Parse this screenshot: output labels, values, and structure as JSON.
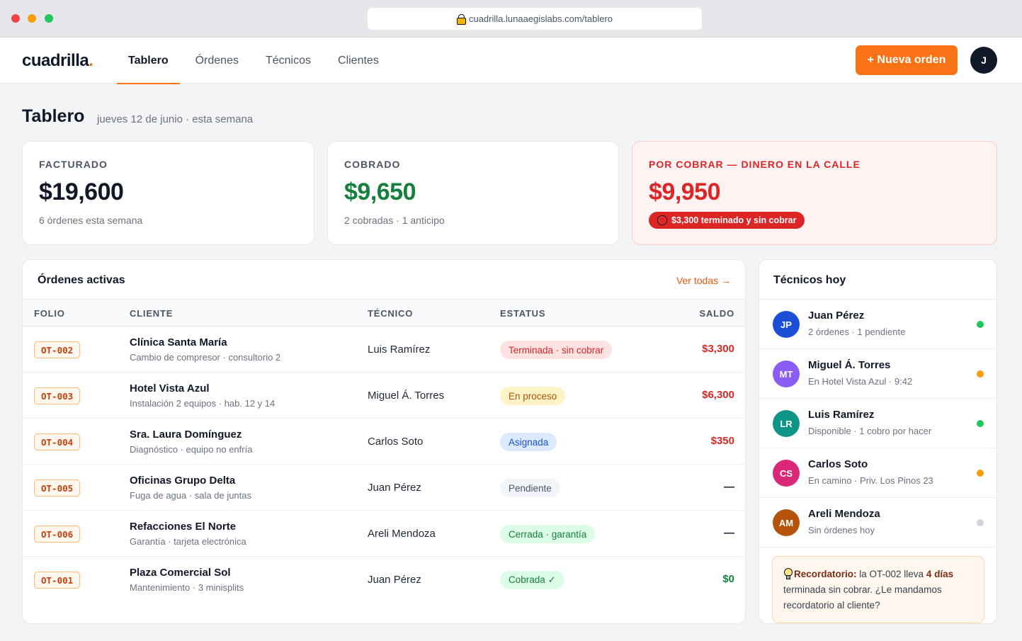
{
  "browser": {
    "url": "cuadrilla.lunaaegislabs.com/tablero"
  },
  "header": {
    "logo": "cuadrilla",
    "logo_dot": ".",
    "nav": [
      {
        "label": "Tablero",
        "active": true
      },
      {
        "label": "Órdenes",
        "active": false
      },
      {
        "label": "Técnicos",
        "active": false
      },
      {
        "label": "Clientes",
        "active": false
      }
    ],
    "new_order_label": "+ Nueva orden",
    "user_initial": "J"
  },
  "page": {
    "title": "Tablero",
    "subtitle": "jueves 12 de junio · esta semana"
  },
  "kpis": [
    {
      "label": "FACTURADO",
      "value": "$19,600",
      "note": "6 órdenes esta semana"
    },
    {
      "label": "COBRADO",
      "value": "$9,650",
      "note": "2 cobradas · 1 anticipo"
    },
    {
      "label": "POR COBRAR — DINERO EN LA CALLE",
      "value": "$9,950",
      "alert": "$3,300 terminado y sin cobrar"
    }
  ],
  "orders": {
    "title": "Órdenes activas",
    "see_all": "Ver todas →",
    "columns": {
      "folio": "FOLIO",
      "cliente": "CLIENTE",
      "tecnico": "TÉCNICO",
      "estatus": "ESTATUS",
      "saldo": "SALDO"
    },
    "rows": [
      {
        "folio": "OT-002",
        "client": "Clínica Santa María",
        "desc": "Cambio de compresor · consultorio 2",
        "tech": "Luis Ramírez",
        "status": "Terminada · sin cobrar",
        "saldo": "$3,300"
      },
      {
        "folio": "OT-003",
        "client": "Hotel Vista Azul",
        "desc": "Instalación 2 equipos · hab. 12 y 14",
        "tech": "Miguel Á. Torres",
        "status": "En proceso",
        "saldo": "$6,300"
      },
      {
        "folio": "OT-004",
        "client": "Sra. Laura Domínguez",
        "desc": "Diagnóstico · equipo no enfría",
        "tech": "Carlos Soto",
        "status": "Asignada",
        "saldo": "$350"
      },
      {
        "folio": "OT-005",
        "client": "Oficinas Grupo Delta",
        "desc": "Fuga de agua · sala de juntas",
        "tech": "Juan Pérez",
        "status": "Pendiente",
        "saldo": "—"
      },
      {
        "folio": "OT-006",
        "client": "Refacciones El Norte",
        "desc": "Garantía · tarjeta electrónica",
        "tech": "Areli Mendoza",
        "status": "Cerrada · garantía",
        "saldo": "—"
      },
      {
        "folio": "OT-001",
        "client": "Plaza Comercial Sol",
        "desc": "Mantenimiento · 3 minisplits",
        "tech": "Juan Pérez",
        "status": "Cobrada ✓",
        "saldo": "$0"
      }
    ]
  },
  "technicians": {
    "title": "Técnicos hoy",
    "items": [
      {
        "initials": "JP",
        "name": "Juan Pérez",
        "status": "2 órdenes · 1 pendiente",
        "avatar_color": "#1d4ed8",
        "dot_color": "#22c55e"
      },
      {
        "initials": "MT",
        "name": "Miguel Á. Torres",
        "status": "En Hotel Vista Azul · 9:42",
        "avatar_color": "#8b5cf6",
        "dot_color": "#f59e0b"
      },
      {
        "initials": "LR",
        "name": "Luis Ramírez",
        "status": "Disponible · 1 cobro por hacer",
        "avatar_color": "#0f9488",
        "dot_color": "#22c55e"
      },
      {
        "initials": "CS",
        "name": "Carlos Soto",
        "status": "En camino · Priv. Los Pinos 23",
        "avatar_color": "#db2777",
        "dot_color": "#f59e0b"
      },
      {
        "initials": "AM",
        "name": "Areli Mendoza",
        "status": "Sin órdenes hoy",
        "avatar_color": "#b45309",
        "dot_color": "#d1d5db"
      }
    ],
    "reminder": {
      "label": "Recordatorio:",
      "text_1": " la OT-002 lleva ",
      "highlight": "4 días",
      "text_2": " terminada sin cobrar. ¿Le mandamos recordatorio al cliente?"
    }
  }
}
